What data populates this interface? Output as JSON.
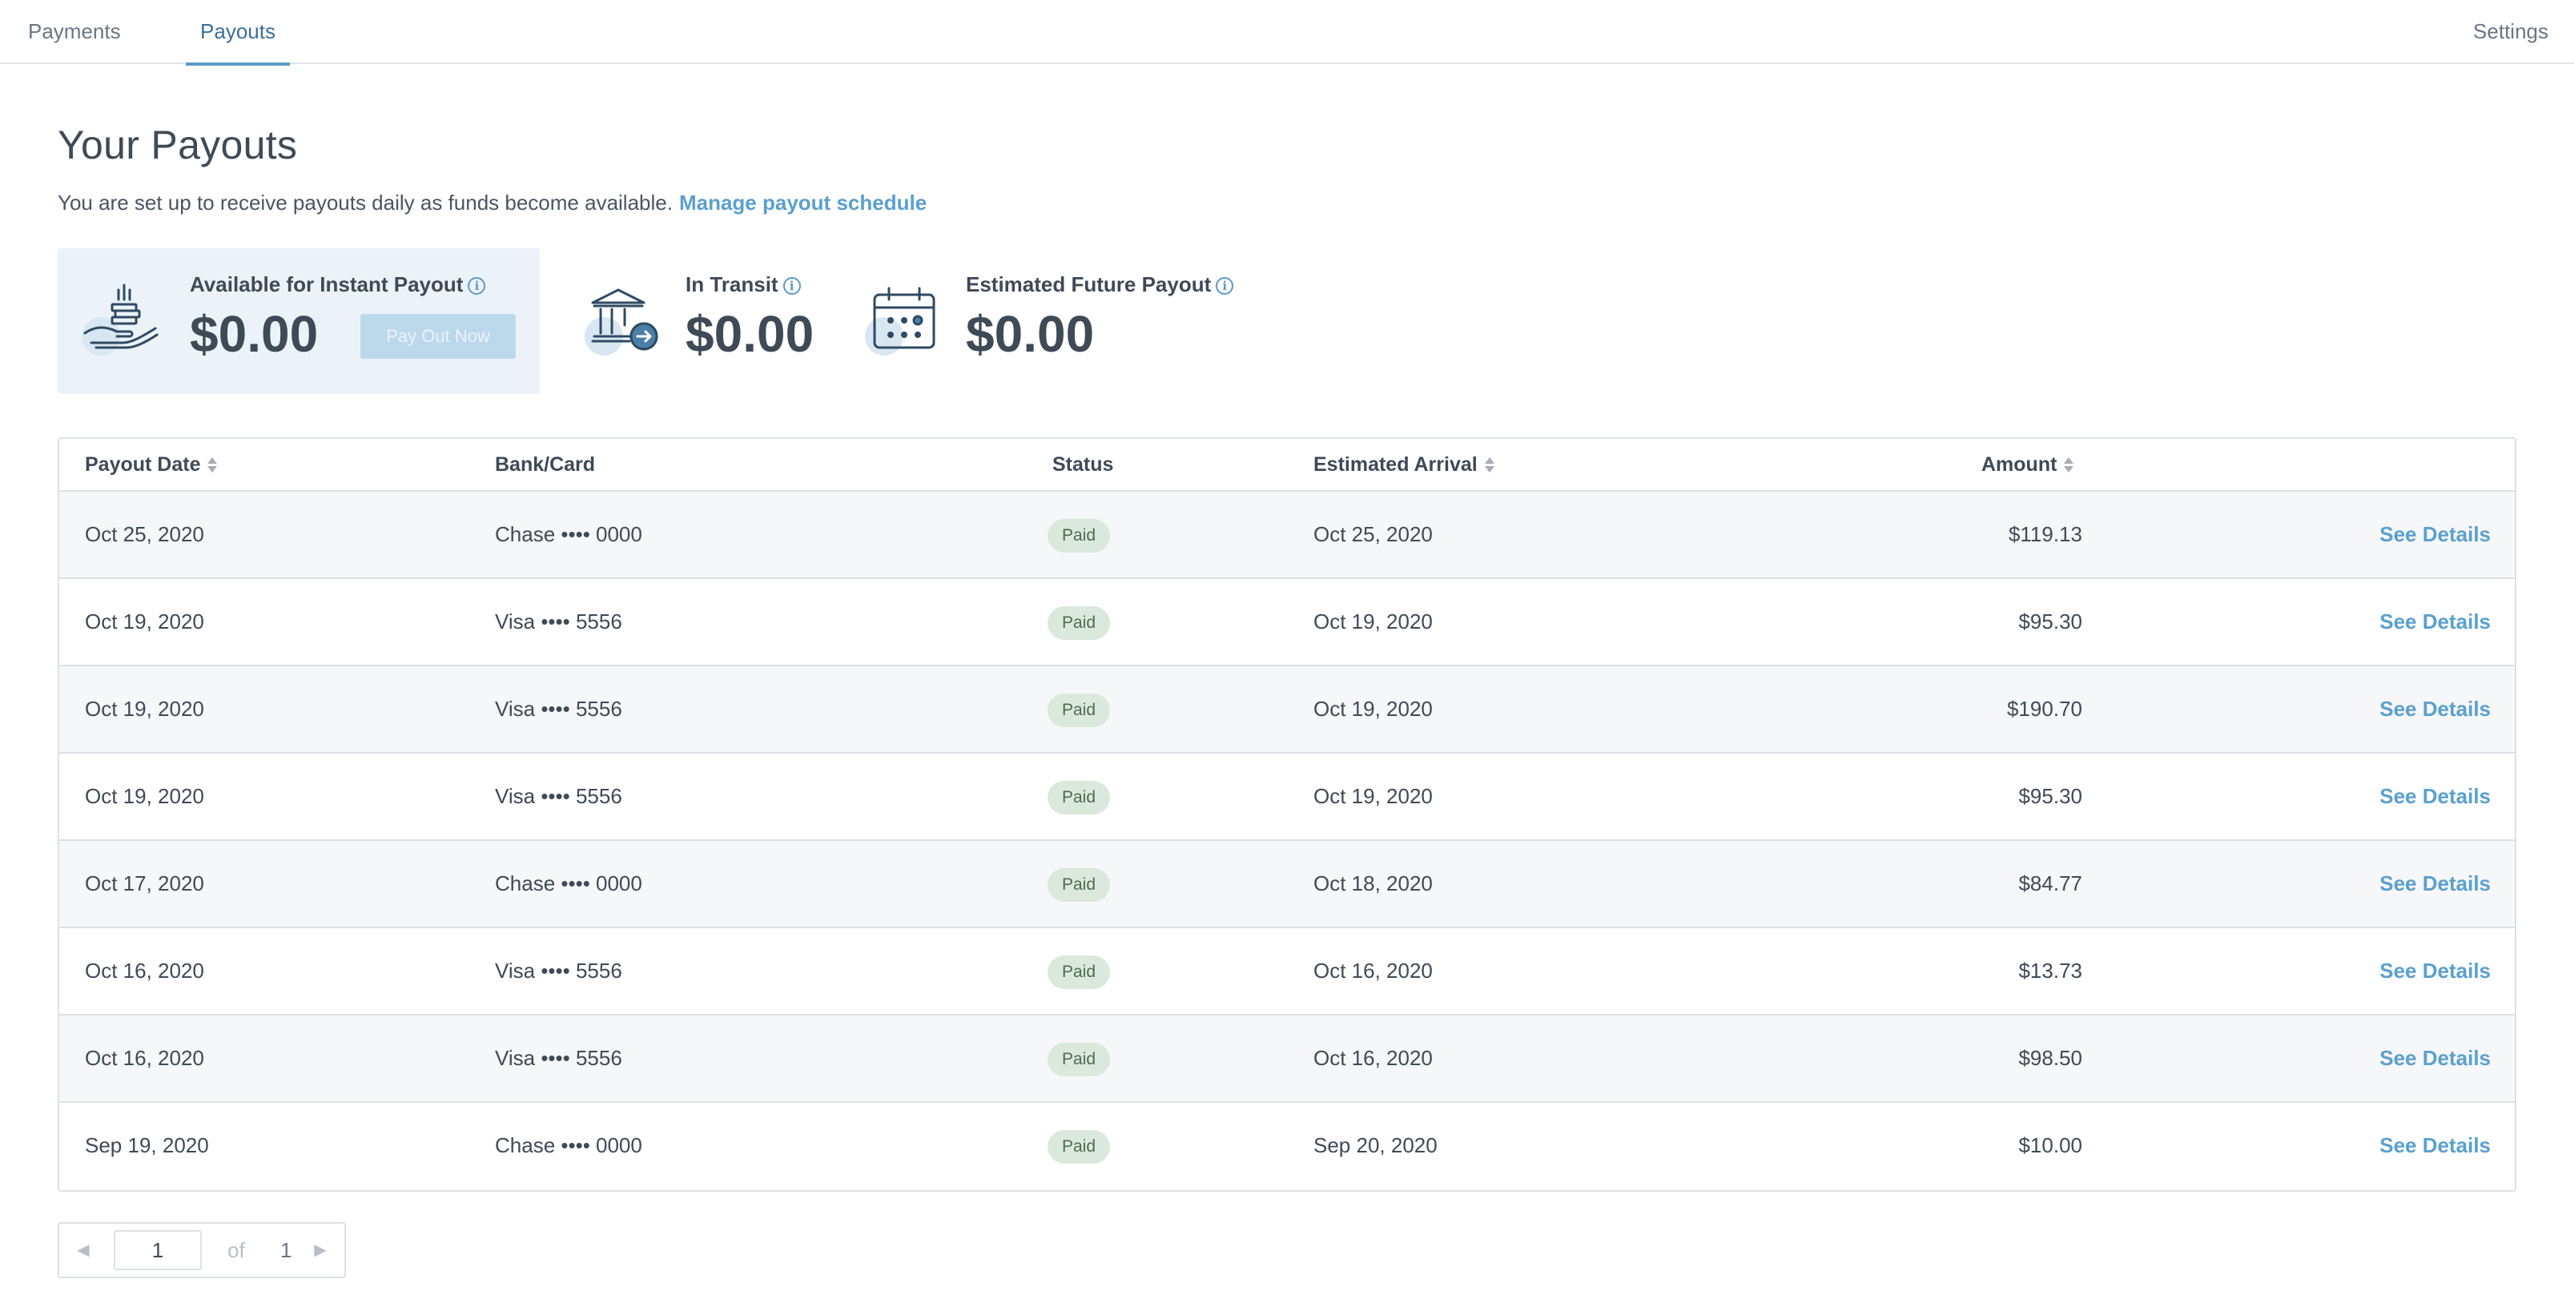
{
  "nav": {
    "tabs": [
      {
        "label": "Payments"
      },
      {
        "label": "Payouts",
        "active": true
      }
    ],
    "settings_label": "Settings"
  },
  "header": {
    "title": "Your Payouts",
    "subtitle": "You are set up to receive payouts daily as funds become available.",
    "schedule_link": "Manage payout schedule"
  },
  "summary": {
    "instant": {
      "label": "Available for Instant Payout",
      "amount": "$0.00",
      "button": "Pay Out Now",
      "icon": "hand-coins-icon"
    },
    "transit": {
      "label": "In Transit",
      "amount": "$0.00",
      "icon": "bank-transfer-icon"
    },
    "future": {
      "label": "Estimated Future Payout",
      "amount": "$0.00",
      "icon": "calendar-icon"
    }
  },
  "table": {
    "columns": {
      "payout_date": "Payout Date",
      "bank_card": "Bank/Card",
      "status": "Status",
      "estimated_arrival": "Estimated Arrival",
      "amount": "Amount"
    },
    "rows": [
      {
        "date": "Oct 25, 2020",
        "bank": "Chase •••• 0000",
        "status": "Paid",
        "arrival": "Oct 25, 2020",
        "amount": "$119.13",
        "action": "See Details"
      },
      {
        "date": "Oct 19, 2020",
        "bank": "Visa •••• 5556",
        "status": "Paid",
        "arrival": "Oct 19, 2020",
        "amount": "$95.30",
        "action": "See Details"
      },
      {
        "date": "Oct 19, 2020",
        "bank": "Visa •••• 5556",
        "status": "Paid",
        "arrival": "Oct 19, 2020",
        "amount": "$190.70",
        "action": "See Details"
      },
      {
        "date": "Oct 19, 2020",
        "bank": "Visa •••• 5556",
        "status": "Paid",
        "arrival": "Oct 19, 2020",
        "amount": "$95.30",
        "action": "See Details"
      },
      {
        "date": "Oct 17, 2020",
        "bank": "Chase •••• 0000",
        "status": "Paid",
        "arrival": "Oct 18, 2020",
        "amount": "$84.77",
        "action": "See Details"
      },
      {
        "date": "Oct 16, 2020",
        "bank": "Visa •••• 5556",
        "status": "Paid",
        "arrival": "Oct 16, 2020",
        "amount": "$13.73",
        "action": "See Details"
      },
      {
        "date": "Oct 16, 2020",
        "bank": "Visa •••• 5556",
        "status": "Paid",
        "arrival": "Oct 16, 2020",
        "amount": "$98.50",
        "action": "See Details"
      },
      {
        "date": "Sep 19, 2020",
        "bank": "Chase •••• 0000",
        "status": "Paid",
        "arrival": "Sep 20, 2020",
        "amount": "$10.00",
        "action": "See Details"
      }
    ]
  },
  "pagination": {
    "current": "1",
    "of_label": "of",
    "total": "1"
  },
  "colors": {
    "accent": "#5aa0cf",
    "paid_badge": "#dbe9dc",
    "instant_card": "#ebf3f9"
  }
}
